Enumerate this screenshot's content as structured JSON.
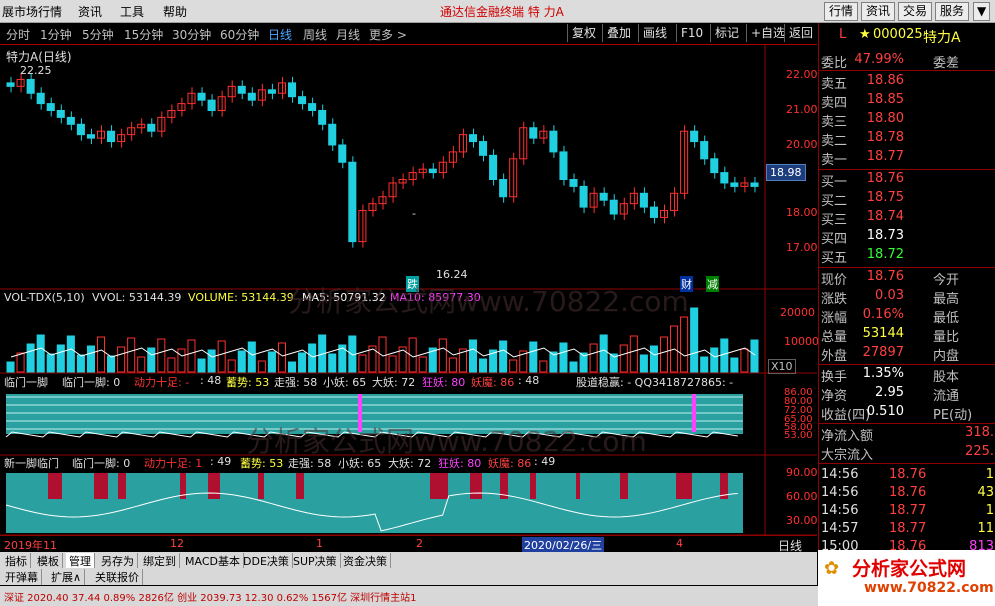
{
  "menu": {
    "items": [
      "展市场行情",
      "资讯",
      "工具",
      "帮助"
    ],
    "title": "通达信金融终端   特 力A",
    "right_buttons": [
      "行情",
      "资讯",
      "交易",
      "服务"
    ]
  },
  "periods": [
    "分时",
    "1分钟",
    "5分钟",
    "15分钟",
    "30分钟",
    "60分钟",
    "日线",
    "周线",
    "月线",
    "更多 >"
  ],
  "active_period": "日线",
  "toolbar": [
    "复权",
    "叠加",
    "画线",
    "F10",
    "标记",
    "+自选",
    "返回"
  ],
  "main_chart": {
    "title": "特力A(日线)",
    "y_ticks": [
      "22.00",
      "21.00",
      "20.00",
      "19.00",
      "18.00",
      "17.00"
    ],
    "current_price_tag": "18.98",
    "high_label": "22.25",
    "low_label": "16.24",
    "badges": {
      "die": "跌",
      "cai": "财",
      "jian": "减"
    },
    "dash": "-"
  },
  "volume": {
    "header": {
      "name": "VOL-TDX(5,10)",
      "vvol": "VVOL: 53144.39",
      "volume": "VOLUME: 53144.39",
      "ma5": "MA5: 50791.32",
      "ma10": "MA10: 85977.30"
    },
    "y_ticks": [
      "20000",
      "10000"
    ],
    "unit": "X10"
  },
  "ind1": {
    "header": {
      "a": "临门一脚",
      "b": "临门一脚: 0",
      "c": "动力十足: -",
      "d": ": 48",
      "e": "蓄势: 53",
      "f": "走强: 58",
      "g": "小妖: 65",
      "h": "大妖: 72",
      "i": "狂妖: 80",
      "j": "妖魔: 86",
      "k": ": 48",
      "l": "股道稳赢: -  QQ3418727865: -"
    },
    "y_ticks": [
      "86.00",
      "80.00",
      "72.00",
      "65.00",
      "58.00",
      "53.00"
    ]
  },
  "ind2": {
    "header": {
      "a": "新一脚临门",
      "b": "临门一脚: 0",
      "c": "动力十足: 1",
      "d": ": 49",
      "e": "蓄势: 53",
      "f": "走强: 58",
      "g": "小妖: 65",
      "h": "大妖: 72",
      "i": "狂妖: 80",
      "j": "妖魔: 86",
      "k": ": 49"
    },
    "y_ticks": [
      "90.00",
      "60.00",
      "30.00"
    ]
  },
  "time_axis": {
    "labels": [
      "2019年11",
      "12",
      "1",
      "2",
      "2020/02/26/三",
      "4"
    ],
    "right": "日线"
  },
  "watermark": "分析家公式网www.70822.com",
  "quote": {
    "code_flag": "L",
    "code": "000025",
    "name": "特力A",
    "ratio": {
      "k": "委比",
      "v": "47.99%",
      "k2": "委差"
    },
    "asks": [
      {
        "k": "卖五",
        "v": "18.86"
      },
      {
        "k": "卖四",
        "v": "18.85"
      },
      {
        "k": "卖三",
        "v": "18.80"
      },
      {
        "k": "卖二",
        "v": "18.78"
      },
      {
        "k": "卖一",
        "v": "18.77"
      }
    ],
    "bids": [
      {
        "k": "买一",
        "v": "18.76"
      },
      {
        "k": "买二",
        "v": "18.75"
      },
      {
        "k": "买三",
        "v": "18.74"
      },
      {
        "k": "买四",
        "v": "18.73"
      },
      {
        "k": "买五",
        "v": "18.72"
      }
    ],
    "stats": [
      {
        "k": "现价",
        "v": "18.76",
        "k2": "今开"
      },
      {
        "k": "涨跌",
        "v": "0.03",
        "k2": "最高"
      },
      {
        "k": "涨幅",
        "v": "0.16%",
        "k2": "最低"
      },
      {
        "k": "总量",
        "v": "53144",
        "k2": "量比"
      },
      {
        "k": "外盘",
        "v": "27897",
        "k2": "内盘"
      },
      {
        "k": "换手",
        "v": "1.35%",
        "k2": "股本"
      },
      {
        "k": "净资",
        "v": "2.95",
        "k2": "流通"
      },
      {
        "k": "收益(四)",
        "v": "0.510",
        "k2": "PE(动)"
      }
    ],
    "flows": [
      {
        "k": "净流入额",
        "v": "318."
      },
      {
        "k": "大宗流入",
        "v": "225."
      }
    ],
    "ticks": [
      {
        "t": "14:56",
        "p": "18.76",
        "n": "1"
      },
      {
        "t": "14:56",
        "p": "18.76",
        "n": "43"
      },
      {
        "t": "14:56",
        "p": "18.77",
        "n": "1"
      },
      {
        "t": "14:57",
        "p": "18.77",
        "n": "11"
      },
      {
        "t": "15:00",
        "p": "18.76",
        "n": "813"
      }
    ]
  },
  "tabs1": [
    "指标",
    "模板",
    "管理",
    "另存为",
    "绑定到",
    "MACD基本",
    "DDE决策",
    "SUP决策",
    "资金决策"
  ],
  "tabs2": [
    "开弹幕",
    "扩展∧",
    "关联报价"
  ],
  "status": "深证   2020.40   37.44   0.89%   2826亿   创业   2039.73   12.30   0.62%   1567亿        深圳行情主站1",
  "logo": {
    "text": "分析家公式网",
    "url": "www.70822.com"
  }
}
